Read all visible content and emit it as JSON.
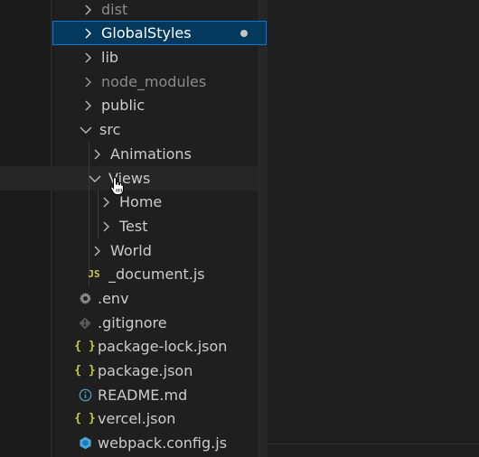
{
  "explorer": {
    "items": [
      {
        "label": "dist",
        "kind": "folder",
        "state": "collapsed",
        "dim": true
      },
      {
        "label": "GlobalStyles",
        "kind": "folder",
        "state": "collapsed",
        "selected": true,
        "modified": true
      },
      {
        "label": "lib",
        "kind": "folder",
        "state": "collapsed"
      },
      {
        "label": "node_modules",
        "kind": "folder",
        "state": "collapsed",
        "dim": true
      },
      {
        "label": "public",
        "kind": "folder",
        "state": "collapsed"
      },
      {
        "label": "src",
        "kind": "folder",
        "state": "expanded"
      },
      {
        "label": "Animations",
        "kind": "folder",
        "state": "collapsed"
      },
      {
        "label": "Views",
        "kind": "folder",
        "state": "expanded"
      },
      {
        "label": "Home",
        "kind": "folder",
        "state": "collapsed"
      },
      {
        "label": "Test",
        "kind": "folder",
        "state": "collapsed"
      },
      {
        "label": "World",
        "kind": "folder",
        "state": "collapsed"
      },
      {
        "label": "_document.js",
        "kind": "file",
        "icon": "js-file-icon",
        "icon_text": "JS"
      },
      {
        "label": ".env",
        "kind": "file",
        "icon": "gear-icon"
      },
      {
        "label": ".gitignore",
        "kind": "file",
        "icon": "git-icon"
      },
      {
        "label": "package-lock.json",
        "kind": "file",
        "icon": "json-file-icon",
        "icon_text": "{ }"
      },
      {
        "label": "package.json",
        "kind": "file",
        "icon": "json-file-icon",
        "icon_text": "{ }"
      },
      {
        "label": "README.md",
        "kind": "file",
        "icon": "info-icon"
      },
      {
        "label": "vercel.json",
        "kind": "file",
        "icon": "json-file-icon",
        "icon_text": "{ }"
      },
      {
        "label": "webpack.config.js",
        "kind": "file",
        "icon": "webpack-cube-icon"
      }
    ]
  },
  "colors": {
    "selection_bg": "#04395e",
    "selection_border": "#0078d4",
    "text": "#cccccc",
    "dim_text": "#8b8b8b",
    "json_icon": "#cbcb41",
    "js_icon": "#cbcb41",
    "info_icon": "#519aba",
    "webpack_icon": "#4aa8d8"
  },
  "cursor": "hand-pointer-icon"
}
